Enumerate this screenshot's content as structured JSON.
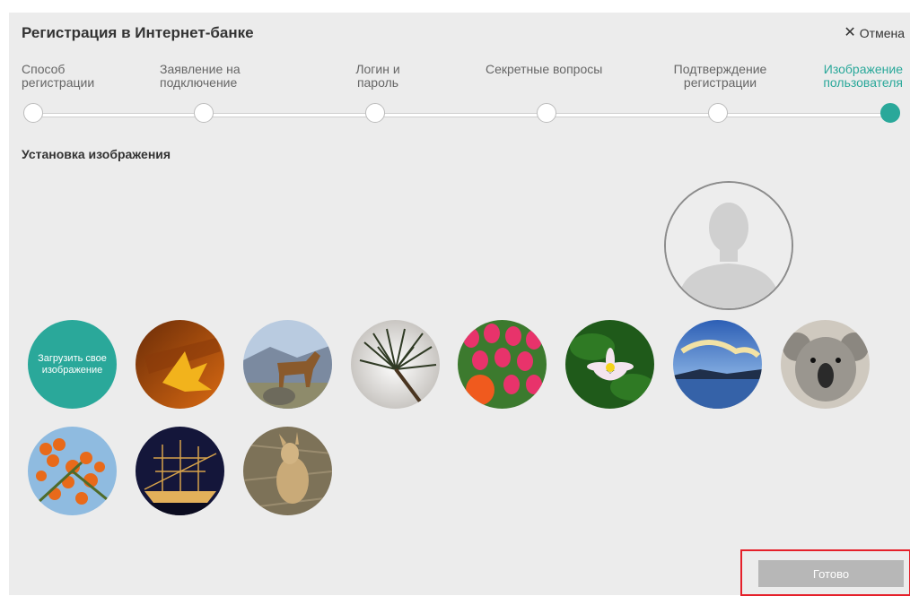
{
  "dialog": {
    "title": "Регистрация в Интернет-банке",
    "cancel_label": "Отмена",
    "section_title": "Установка изображения",
    "done_label": "Готово",
    "upload_label": "Загрузить свое изображение"
  },
  "steps": [
    {
      "label": "Способ регистрации",
      "active": false
    },
    {
      "label": "Заявление на подключение",
      "active": false
    },
    {
      "label": "Логин и пароль",
      "active": false
    },
    {
      "label": "Секретные вопросы",
      "active": false
    },
    {
      "label": "Подтверждение регистрации",
      "active": false
    },
    {
      "label": "Изображение пользователя",
      "active": true
    }
  ],
  "images": [
    "autumn-leaf",
    "horse",
    "pine-branch",
    "tulips",
    "water-lily",
    "lake-sunset",
    "koala",
    "rowan-berries",
    "sailing-ship",
    "kangaroo"
  ],
  "colors": {
    "accent": "#2aa89a",
    "highlight": "#e5202a",
    "button": "#b7b7b7"
  }
}
